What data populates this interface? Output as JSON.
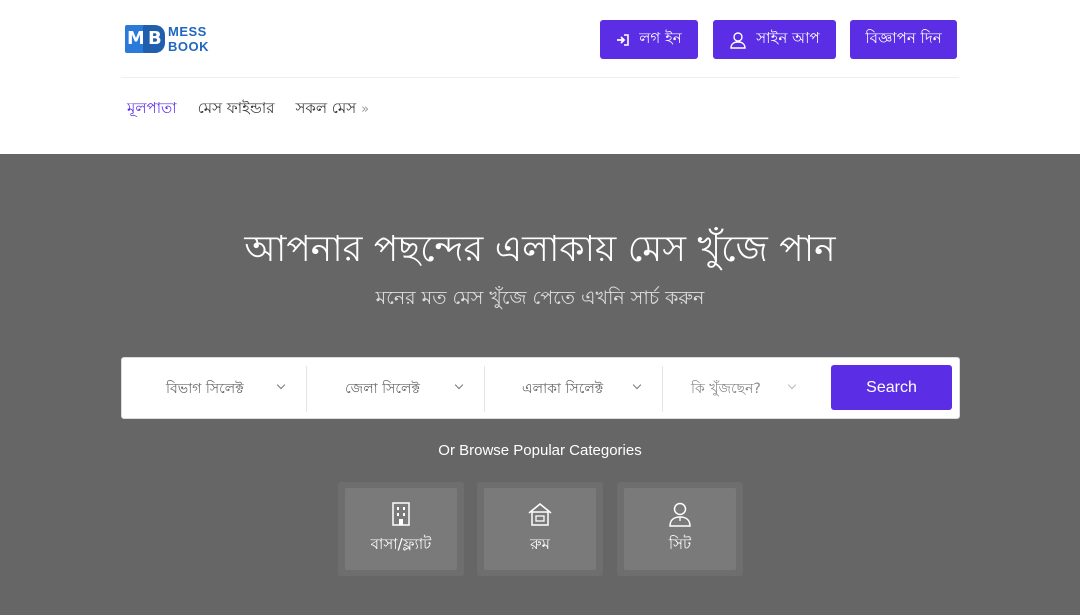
{
  "brand": {
    "line1": "MESS",
    "line2": "BOOK",
    "primary_color": "#5b2ee6"
  },
  "header": {
    "login_label": "লগ ইন",
    "signup_label": "সাইন আপ",
    "ad_label": "বিজ্ঞাপন দিন"
  },
  "nav": {
    "home": "মূলপাতা",
    "finder": "মেস ফাইন্ডার",
    "all_mess": "সকল মেস",
    "chevron": "»"
  },
  "hero": {
    "title": "আপনার পছন্দের এলাকায় মেস খুঁজে পান",
    "subtitle": "মনের মত মেস খুঁজে পেতে এখনি সার্চ করুন"
  },
  "search": {
    "division": "বিভাগ সিলেক্ট",
    "district": "জেলা সিলেক্ট",
    "area": "এলাকা সিলেক্ট",
    "looking_for": "কি খুঁজছেন?",
    "button": "Search"
  },
  "browse": {
    "label": "Or Browse Popular Categories",
    "categories": [
      {
        "label": "বাসা/ফ্ল্যাট",
        "icon": "building-icon"
      },
      {
        "label": "রুম",
        "icon": "house-icon"
      },
      {
        "label": "সিট",
        "icon": "person-icon"
      }
    ]
  }
}
